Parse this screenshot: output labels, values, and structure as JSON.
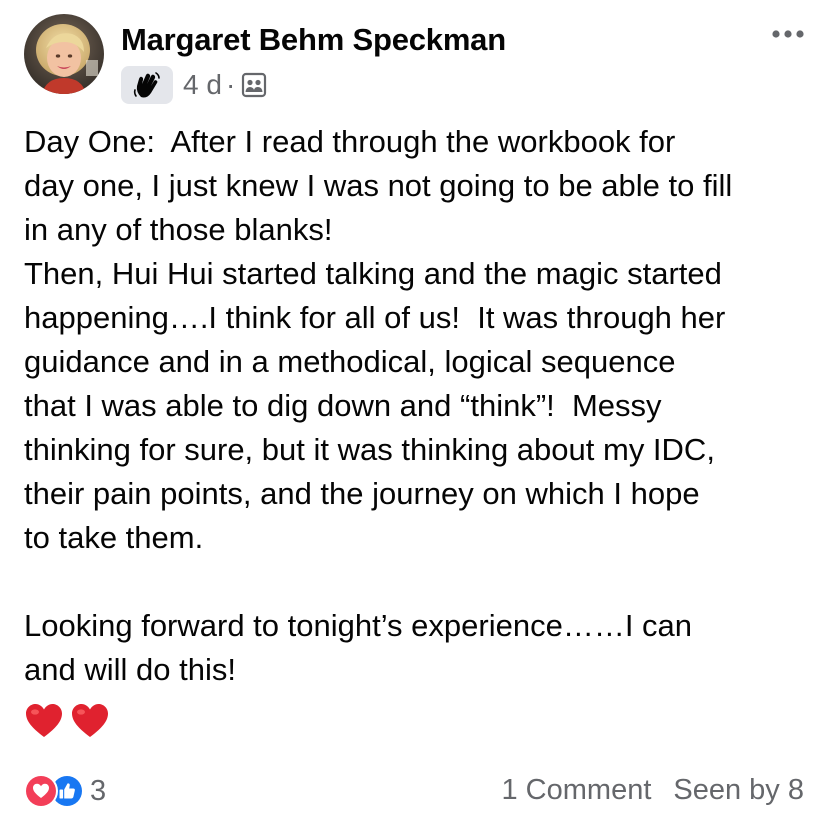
{
  "post": {
    "author": "Margaret Behm Speckman",
    "timestamp": "4 d",
    "separator": "·",
    "badge_icon": "waving-hand-icon",
    "audience_icon": "group-members-icon",
    "more_icon": "more-options-icon",
    "body_lines": [
      "Day One:  After I read through the workbook for",
      "day one, I just knew I was not going to be able to fill",
      "in any of those blanks!",
      "Then, Hui Hui started talking and the magic started",
      "happening….I think for all of us!  It was through her",
      "guidance and in a methodical, logical sequence",
      "that I was able to dig down and “think”!  Messy",
      "thinking for sure, but it was thinking about my IDC,",
      "their pain points, and the journey on which I hope",
      "to take them.",
      "",
      "Looking forward to tonight’s experience……I can",
      "and will do this!"
    ],
    "hearts_emoji": [
      "red-heart-icon",
      "red-heart-icon"
    ]
  },
  "footer": {
    "reaction_icons": [
      "love-reaction-icon",
      "like-reaction-icon"
    ],
    "reaction_count": "3",
    "comments": "1 Comment",
    "seen_by": "Seen by 8"
  },
  "colors": {
    "text_primary": "#050505",
    "text_secondary": "#65676b",
    "like_blue": "#1877f2",
    "love_red": "#f33e58",
    "badge_bg": "#e4e6eb"
  }
}
